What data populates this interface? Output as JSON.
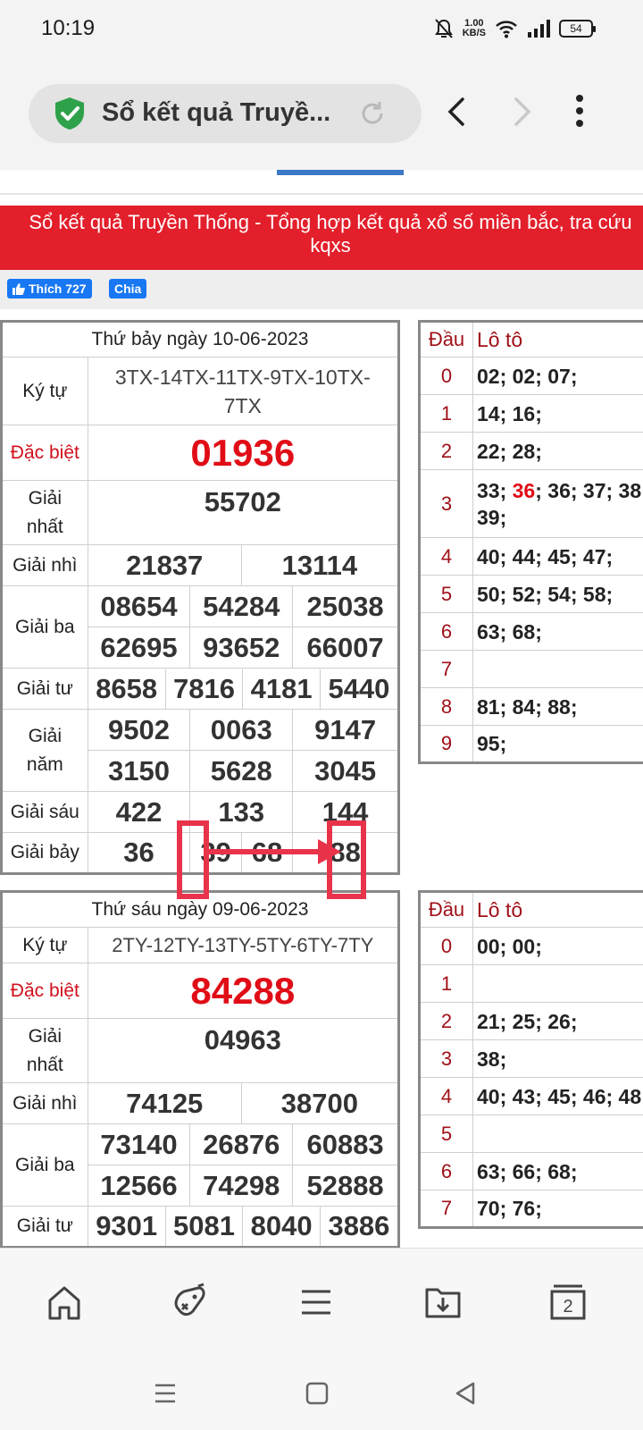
{
  "status_bar": {
    "time": "10:19",
    "net_speed_value": "1.00",
    "net_speed_unit": "KB/S",
    "battery": "54"
  },
  "browser": {
    "title": "Sổ kết quả Truyề..."
  },
  "page": {
    "banner_line1": "Sổ kết quả Truyền Thống - Tổng hợp kết quả xổ số miền bắc, tra cứu",
    "banner_line2": "kqxs",
    "fb_like_label": "Thích 727",
    "fb_share_label": "Chia"
  },
  "labels": {
    "ky_tu": "Ký tự",
    "dac_biet": "Đặc biệt",
    "giai_nhat_1": "Giải",
    "giai_nhat_2": "nhất",
    "giai_nhi": "Giải nhì",
    "giai_ba": "Giải ba",
    "giai_tu": "Giải tư",
    "giai_nam_1": "Giải",
    "giai_nam_2": "năm",
    "giai_sau": "Giải sáu",
    "giai_bay": "Giải bảy",
    "dau": "Đầu",
    "lo_to": "Lô tô"
  },
  "results": [
    {
      "date": "Thứ bảy ngày 10-06-2023",
      "ky_tu_line1": "3TX-14TX-11TX-9TX-10TX-",
      "ky_tu_line2": "7TX",
      "dac_biet": "01936",
      "giai_nhat": "55702",
      "giai_nhi": [
        "21837",
        "13114"
      ],
      "giai_ba": [
        "08654",
        "54284",
        "25038",
        "62695",
        "93652",
        "66007"
      ],
      "giai_tu": [
        "8658",
        "7816",
        "4181",
        "5440"
      ],
      "giai_nam": [
        "9502",
        "0063",
        "9147",
        "3150",
        "5628",
        "3045"
      ],
      "giai_sau": [
        "422",
        "133",
        "144"
      ],
      "giai_bay": [
        "36",
        "39",
        "68",
        "88"
      ],
      "loto": [
        {
          "dau": "0",
          "pre": "02; 02; 07;",
          "hl": "",
          "post": ""
        },
        {
          "dau": "1",
          "pre": "14; 16;",
          "hl": "",
          "post": ""
        },
        {
          "dau": "2",
          "pre": "22; 28;",
          "hl": "",
          "post": ""
        },
        {
          "dau": "3",
          "pre": "33; ",
          "hl": "36",
          "post": "; 36; 37; 38;",
          "line2": "39;"
        },
        {
          "dau": "4",
          "pre": "40; 44; 45; 47;",
          "hl": "",
          "post": ""
        },
        {
          "dau": "5",
          "pre": "50; 52; 54; 58;",
          "hl": "",
          "post": ""
        },
        {
          "dau": "6",
          "pre": "63; 68;",
          "hl": "",
          "post": ""
        },
        {
          "dau": "7",
          "pre": "",
          "hl": "",
          "post": ""
        },
        {
          "dau": "8",
          "pre": "81; 84; 88;",
          "hl": "",
          "post": ""
        },
        {
          "dau": "9",
          "pre": "95;",
          "hl": "",
          "post": ""
        }
      ]
    },
    {
      "date": "Thứ sáu ngày 09-06-2023",
      "ky_tu_line1": "2TY-12TY-13TY-5TY-6TY-7TY",
      "dac_biet": "84288",
      "giai_nhat": "04963",
      "giai_nhi": [
        "74125",
        "38700"
      ],
      "giai_ba": [
        "73140",
        "26876",
        "60883",
        "12566",
        "74298",
        "52888"
      ],
      "giai_tu": [
        "9301",
        "5081",
        "8040",
        "3886"
      ],
      "loto": [
        {
          "dau": "0",
          "pre": "00; 00;",
          "hl": "",
          "post": ""
        },
        {
          "dau": "1",
          "pre": "",
          "hl": "",
          "post": ""
        },
        {
          "dau": "2",
          "pre": "21; 25; 26;",
          "hl": "",
          "post": ""
        },
        {
          "dau": "3",
          "pre": "38;",
          "hl": "",
          "post": ""
        },
        {
          "dau": "4",
          "pre": "40; 43; 45; 46; 48;",
          "hl": "",
          "post": ""
        },
        {
          "dau": "5",
          "pre": "",
          "hl": "",
          "post": ""
        },
        {
          "dau": "6",
          "pre": "63; 66; 68;",
          "hl": "",
          "post": ""
        },
        {
          "dau": "7",
          "pre": "70; 76;",
          "hl": "",
          "post": ""
        }
      ]
    }
  ],
  "colors": {
    "banner": "#e21f2b",
    "special_prize": "#e00d17",
    "annotation": "#e8334a",
    "tab_accent": "#3c78c6"
  }
}
